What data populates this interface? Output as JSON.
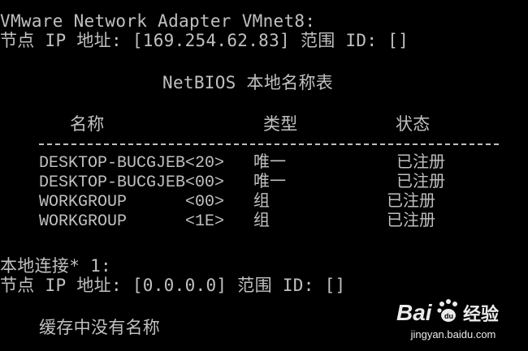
{
  "console": {
    "adapter_header": "VMware Network Adapter VMnet8:",
    "adapter_ip_line": "节点 IP 地址: [169.254.62.83] 范围 ID: []",
    "table_title": "NetBIOS 本地名称表",
    "columns": [
      "名称",
      "类型",
      "状态"
    ],
    "rows": [
      {
        "name": "DESKTOP-BUCGJEB<20>",
        "type": "唯一",
        "status": "已注册"
      },
      {
        "name": "DESKTOP-BUCGJEB<00>",
        "type": "唯一",
        "status": "已注册"
      },
      {
        "name": "WORKGROUP      <00>",
        "type": "组",
        "status": "已注册"
      },
      {
        "name": "WORKGROUP      <1E>",
        "type": "组",
        "status": "已注册"
      }
    ],
    "local_conn_header": "本地连接* 1:",
    "local_conn_ip_line": "节点 IP 地址: [0.0.0.0] 范围 ID: []",
    "cache_empty": "缓存中没有名称"
  },
  "watermark": {
    "logo_text": "Bai",
    "logo_text2": "du",
    "logo_cn": "经验",
    "url": "jingyan.baidu.com",
    "icon": "baidu-paw-icon"
  },
  "colors": {
    "background": "#000000",
    "text": "#c0c0c0"
  }
}
